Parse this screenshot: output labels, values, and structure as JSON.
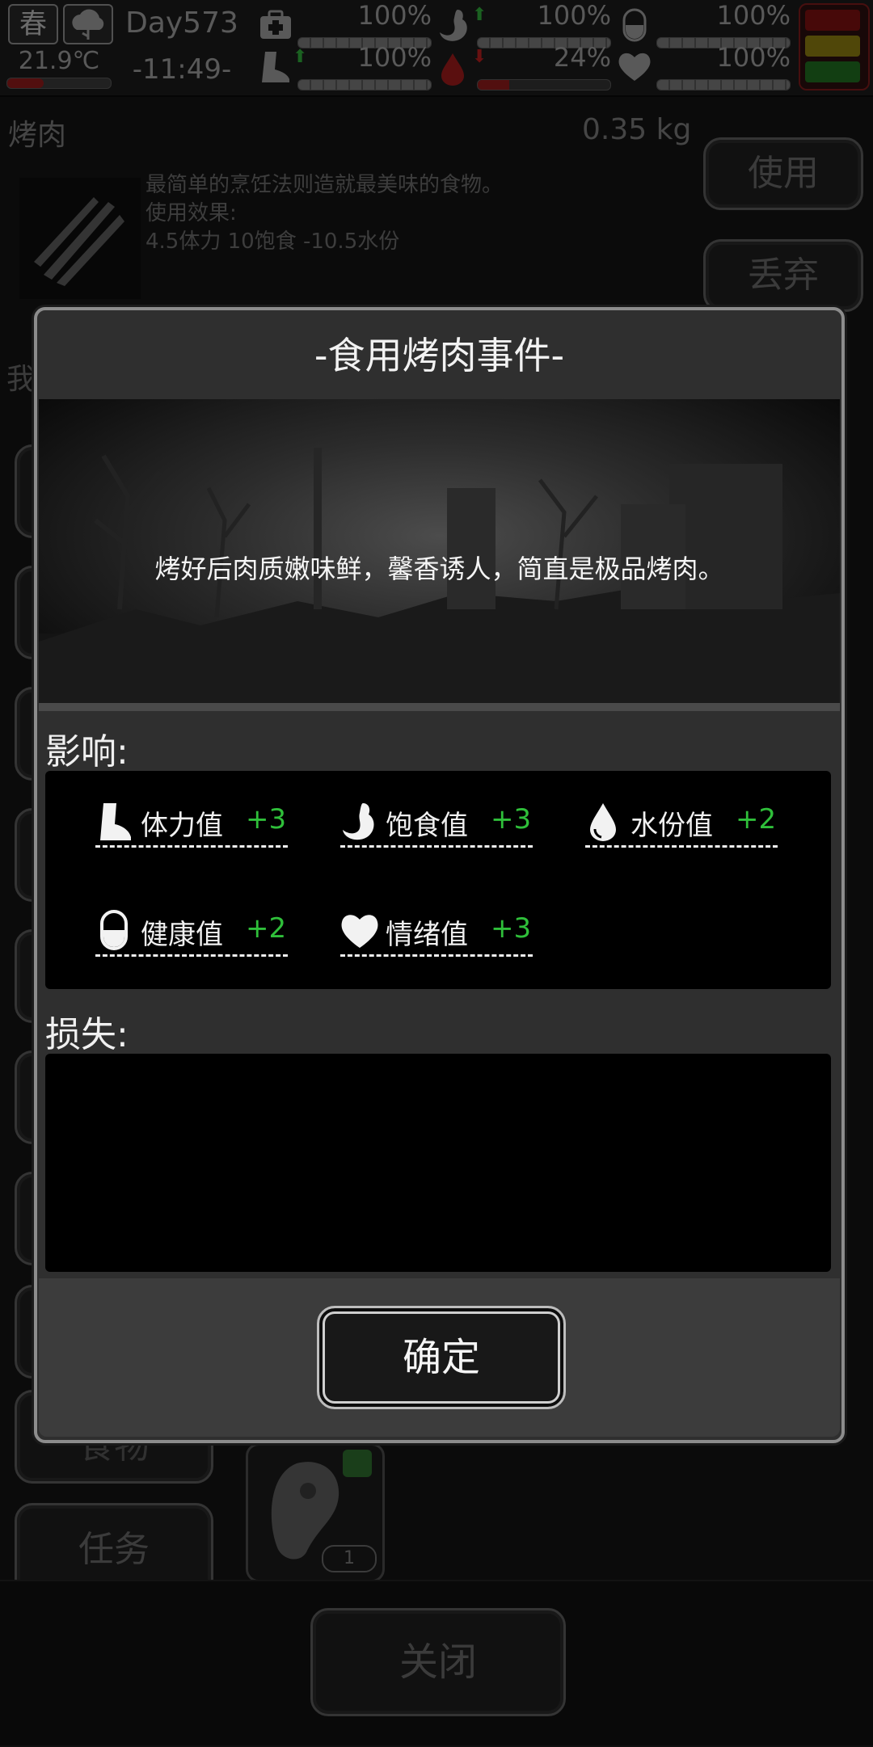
{
  "status": {
    "season": "春",
    "temperature": "21.9℃",
    "temperature_level": 0.35,
    "day": "Day573",
    "time": "-11:49-",
    "stats": [
      {
        "id": "medical",
        "icon": "medkit-icon",
        "percent": "100%",
        "level": 1.0
      },
      {
        "id": "hunger",
        "icon": "stomach-icon",
        "percent": "100%",
        "level": 1.0
      },
      {
        "id": "health",
        "icon": "pill-icon",
        "percent": "100%",
        "level": 1.0
      },
      {
        "id": "stamina",
        "icon": "boot-icon",
        "percent": "100%",
        "level": 1.0
      },
      {
        "id": "water",
        "icon": "water-drop-icon",
        "percent": "24%",
        "level": 0.24
      },
      {
        "id": "mood",
        "icon": "heart-icon",
        "percent": "100%",
        "level": 1.0
      }
    ],
    "signal_colors": [
      "#7a1010",
      "#8a7a10",
      "#1f6b1f"
    ]
  },
  "item": {
    "name": "烤肉",
    "weight": "0.35 kg",
    "description": [
      "最简单的烹饪法则造就最美味的食物。",
      "使用效果:",
      "4.5体力 10饱食 -10.5水份"
    ],
    "use_label": "使用",
    "drop_label": "丢弃"
  },
  "side": {
    "fragment": "我",
    "food_label": "食物",
    "task_label": "任务"
  },
  "inventory": {
    "count": "1"
  },
  "close_label": "关闭",
  "dialog": {
    "title": "-食用烤肉事件-",
    "scene_text": "烤好后肉质嫩味鲜，馨香诱人，简直是极品烤肉。",
    "effects_label": "影响:",
    "effects": [
      {
        "icon": "boot-icon",
        "name": "体力值",
        "value": "+3"
      },
      {
        "icon": "stomach-icon",
        "name": "饱食值",
        "value": "+3"
      },
      {
        "icon": "water-drop-icon",
        "name": "水份值",
        "value": "+2"
      },
      {
        "icon": "pill-icon",
        "name": "健康值",
        "value": "+2"
      },
      {
        "icon": "heart-icon",
        "name": "情绪值",
        "value": "+3"
      }
    ],
    "loss_label": "损失:",
    "confirm_label": "确定",
    "value_color": "#2fbf3a"
  }
}
